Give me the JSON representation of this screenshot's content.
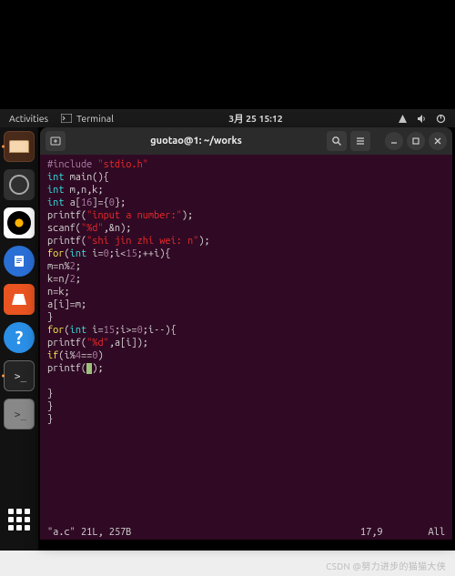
{
  "topbar": {
    "activities": "Activities",
    "terminal": "Terminal",
    "clock": "3月 25  15:12"
  },
  "dock": {
    "items": [
      {
        "name": "files-launcher",
        "label": "Files"
      },
      {
        "name": "system-monitor-launcher",
        "label": "System"
      },
      {
        "name": "rhythmbox-launcher",
        "label": "Media"
      },
      {
        "name": "libreoffice-writer-launcher",
        "label": "Writer"
      },
      {
        "name": "software-launcher",
        "label": "Software"
      },
      {
        "name": "help-launcher",
        "label": "Help"
      },
      {
        "name": "terminal-launcher-dark",
        "label": "Terminal"
      },
      {
        "name": "terminal-launcher-light",
        "label": "Terminal"
      }
    ],
    "show_apps": "Show Applications"
  },
  "window": {
    "title": "guotao@1: ~/works"
  },
  "editor": {
    "file": "\"a.c\"",
    "meta": "21L, 257B",
    "row_col": "17,9",
    "mode": "All",
    "code": {
      "l1_pre": "#include",
      "l1_str": "\"stdio.h\"",
      "l2_t": "int",
      "l2_r": " main(){",
      "l3_t": "int",
      "l3_r": " m,n,k;",
      "l4_t": "int",
      "l4_r": " a[",
      "l4_n": "16",
      "l4_r2": "]={",
      "l4_n2": "0",
      "l4_r3": "};",
      "l5_f": "printf(",
      "l5_s": "\"input a number:\"",
      "l5_e": ");",
      "l6_f": "scanf(",
      "l6_s": "\"%d\"",
      "l6_e": ",&n);",
      "l7_f": "printf(",
      "l7_s": "\"shi jin zhi wei: n\"",
      "l7_e": ");",
      "l8_k": "for",
      "l8_a": "(",
      "l8_t": "int",
      "l8_b": " i=",
      "l8_n1": "0",
      "l8_c": ";i<",
      "l8_n2": "15",
      "l8_d": ";++i){",
      "l9": "m=n%",
      "l9_n": "2",
      "l9_e": ";",
      "l10": "k=n/",
      "l10_n": "2",
      "l10_e": ";",
      "l11": "n=k;",
      "l12": "a[i]=m;",
      "l13": "}",
      "l14_k": "for",
      "l14_a": "(",
      "l14_t": "int",
      "l14_b": " i=",
      "l14_n1": "15",
      "l14_c": ";i>=",
      "l14_n2": "0",
      "l14_d": ";i--){",
      "l15_f": "printf(",
      "l15_s": "\"%d\"",
      "l15_e": ",a[i]);",
      "l16_k": "if",
      "l16_a": "(i%",
      "l16_n": "4",
      "l16_b": "==",
      "l16_n2": "0",
      "l16_c": ")",
      "l17_f": "printf(",
      "l17_cur": " ",
      "l17_e": ");",
      "l18": "",
      "l19": "}",
      "l20": "}",
      "l21": "}"
    }
  },
  "watermark": "CSDN @努力进步的猫猫大侠"
}
